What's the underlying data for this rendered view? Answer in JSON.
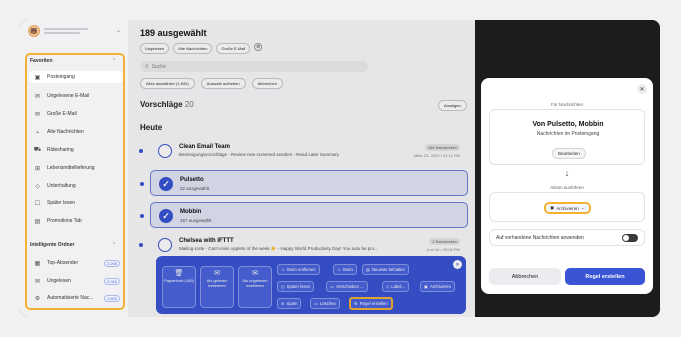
{
  "sidebar": {
    "favorites_title": "Favoriten",
    "items": [
      {
        "icon": "inbox-icon",
        "label": "Posteingang",
        "active": true
      },
      {
        "icon": "unread-mail-icon",
        "label": "Ungelesene E-Mail"
      },
      {
        "icon": "large-mail-icon",
        "label": "Große E-Mail"
      },
      {
        "icon": "old-mail-icon",
        "label": "Alte Nachrichten"
      },
      {
        "icon": "rideshare-icon",
        "label": "Ridesharing"
      },
      {
        "icon": "food-delivery-icon",
        "label": "Lebensmittellieferung"
      },
      {
        "icon": "entertainment-icon",
        "label": "Unterhaltung"
      },
      {
        "icon": "read-later-icon",
        "label": "Später lesen"
      },
      {
        "icon": "promotions-icon",
        "label": "Promotions Tab"
      }
    ],
    "smart_title": "Intelligente Ordner",
    "smart_items": [
      {
        "icon": "top-senders-icon",
        "label": "Top-Absender",
        "count": "2.205"
      },
      {
        "icon": "unread-icon",
        "label": "Ungelesen",
        "count": "2.016"
      },
      {
        "icon": "auto-icon",
        "label": "Automatisierte Nac...",
        "count": "1.603"
      }
    ]
  },
  "main": {
    "title": "189 ausgewählt",
    "filters": [
      "Ungelesen",
      "Alte Nachrichten",
      "Große E-Mail"
    ],
    "filter_clear": "⊗",
    "search_placeholder": "Suche",
    "select_buttons": [
      "Alles auswählen (1.840)",
      "Auswahl aufheben",
      "Abbrechen"
    ],
    "suggestions_label": "Vorschläge",
    "suggestions_count": "20",
    "show_button": "Anzeigen",
    "today_label": "Heute",
    "rows": [
      {
        "sender": "Clean Email Team",
        "subject": "Bereinigungsvorschläge - Review new screened senders - Read Later Summary",
        "badge": "164 Nachrichten",
        "date": "März 25, 2024 • 01:11 PM",
        "selected": false
      },
      {
        "sender": "Pulsetto",
        "subject": "32 ausgewählt",
        "badge": "",
        "date": "",
        "selected": true
      },
      {
        "sender": "Mobbin",
        "subject": "157 ausgewählt",
        "badge": "",
        "date": "",
        "selected": true
      },
      {
        "sender": "Chelsea with IFTTT",
        "subject": "Mailing-Liste - Can't-miss Applets of the week ☀️ - Happy World Productivity Day! You auto be pro...",
        "badge": "2 Nachrichten",
        "date": "Juni 16 • 05:06 PM",
        "selected": false
      }
    ],
    "actions": {
      "big": [
        {
          "icon": "trash-icon",
          "label": "Papierkorb (189)"
        },
        {
          "icon": "mark-read-icon",
          "label": "Als gelesen markieren"
        },
        {
          "icon": "mark-unread-icon",
          "label": "Als ungelesen markieren"
        }
      ],
      "row1": [
        {
          "icon": "star-remove-icon",
          "label": "Stern entfernen"
        },
        {
          "icon": "star-icon",
          "label": "Stern"
        },
        {
          "icon": "keep-newest-icon",
          "label": "Neueste behalten"
        }
      ],
      "row2": [
        {
          "icon": "clock-icon",
          "label": "Später lesen"
        },
        {
          "icon": "move-icon",
          "label": "Verschieben ..."
        },
        {
          "icon": "label-icon",
          "label": "Label..."
        },
        {
          "icon": "archive-icon",
          "label": "Archivieren"
        }
      ],
      "row3": [
        {
          "icon": "spam-icon",
          "label": "Spam"
        },
        {
          "icon": "delete-icon",
          "label": "Löschen"
        },
        {
          "icon": "rule-icon",
          "label": "Regel erstellen"
        }
      ]
    }
  },
  "dialog": {
    "for_messages_label": "Für Nachrichten",
    "sender_title": "Von Pulsetto, Mobbin",
    "sender_sub": "Nachrichten im Posteingang",
    "edit_button": "Bearbeiten",
    "action_label": "Aktion ausführen",
    "action_value": "Archivieren",
    "toggle_label": "Auf vorhandene Nachrichten anwenden",
    "cancel_button": "Abbrechen",
    "create_button": "Regel erstellen"
  }
}
